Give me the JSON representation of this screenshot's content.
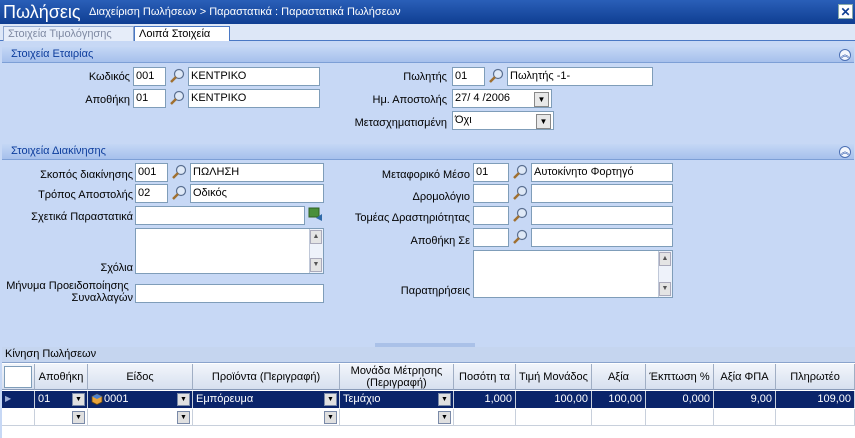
{
  "window": {
    "title": "Πωλήσεις",
    "subtitle": "Διαχείριση Πωλήσεων > Παραστατικά : Παραστατικά Πωλήσεων",
    "close_glyph": "✕"
  },
  "tabs": [
    "Στοιχεία Τιμολόγησης",
    "Λοιπά Στοιχεία"
  ],
  "company": {
    "section_title": "Στοιχεία Εταιρίας",
    "code_label": "Κωδικός",
    "code_value": "001",
    "code_desc": "ΚΕΝΤΡΙΚΟ",
    "warehouse_label": "Αποθήκη",
    "warehouse_value": "01",
    "warehouse_desc": "ΚΕΝΤΡΙΚΟ",
    "seller_label": "Πωλητής",
    "seller_value": "01",
    "seller_desc": "Πωλητής -1-",
    "ship_date_label": "Ημ. Αποστολής",
    "ship_date_value": "27/ 4 /2006",
    "converted_label": "Μετασχηματισμένη",
    "converted_value": "Όχι"
  },
  "movement": {
    "section_title": "Στοιχεία Διακίνησης",
    "purpose_label": "Σκοπός διακίνησης",
    "purpose_value": "001",
    "purpose_desc": "ΠΩΛΗΣΗ",
    "shipmethod_label": "Τρόπος Αποστολής",
    "shipmethod_value": "02",
    "shipmethod_desc": "Οδικός",
    "related_label": "Σχετικά Παραστατικά",
    "related_value": "",
    "comments_label": "Σχόλια",
    "comments_value": "",
    "warning_label_1": "Μήνυμα Προειδοποίησης",
    "warning_label_2": "Συναλλαγών",
    "warning_value": "",
    "transport_label": "Μεταφορικό Μέσο",
    "transport_value": "01",
    "transport_desc": "Αυτοκίνητο Φορτηγό",
    "route_label": "Δρομολόγιο",
    "route_value": "",
    "route_desc": "",
    "sector_label": "Τομέας Δραστηριότητας",
    "sector_value": "",
    "sector_desc": "",
    "dest_wh_label": "Αποθήκη Σε",
    "dest_wh_value": "",
    "dest_wh_desc": "",
    "notes_label": "Παρατηρήσεις",
    "notes_value": ""
  },
  "grid": {
    "title": "Κίνηση Πωλήσεων",
    "columns": [
      "Αποθήκη",
      "Είδος",
      "Προϊόντα (Περιγραφή)",
      "Μονάδα Μέτρησης (Περιγραφή)",
      "Ποσότη τα",
      "Τιμή Μονάδος",
      "Αξία",
      "Έκπτωση %",
      "Αξία ΦΠΑ",
      "Πληρωτέο"
    ],
    "rows": [
      {
        "warehouse": "01",
        "item": "0001",
        "product": "Εμπόρευμα",
        "unit": "Τεμάχιο",
        "qty": "1,000",
        "price": "100,00",
        "value": "100,00",
        "discount": "0,000",
        "vat": "9,00",
        "payable": "109,00"
      }
    ]
  },
  "colors": {
    "accent": "#0f3e92",
    "panel": "#c7d8f5",
    "selection": "#0a246a"
  }
}
